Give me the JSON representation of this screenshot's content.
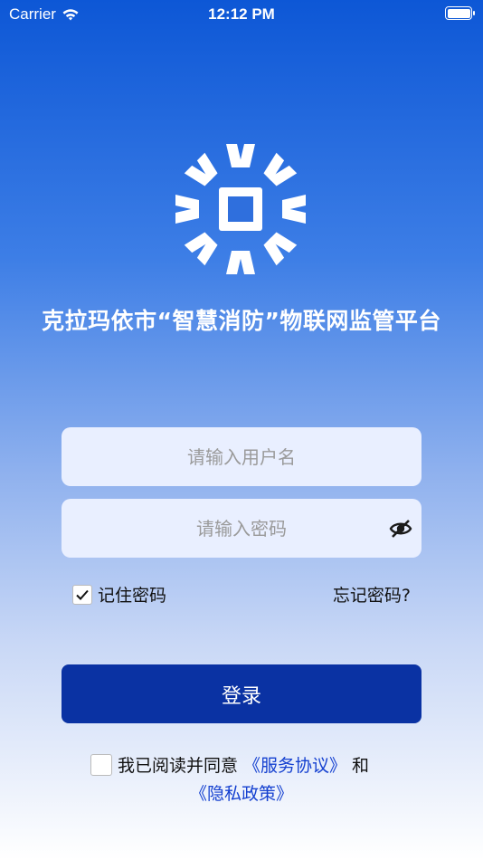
{
  "status_bar": {
    "carrier": "Carrier",
    "time": "12:12 PM"
  },
  "app": {
    "title": "克拉玛依市“智慧消防”物联网监管平台",
    "logo_icon": "fire-iot-logo-icon"
  },
  "login_form": {
    "username_placeholder": "请输入用户名",
    "username_value": "",
    "password_placeholder": "请输入密码",
    "password_value": "",
    "password_toggle_icon": "eye-slash-icon",
    "remember_label": "记住密码",
    "remember_checked": true,
    "forgot_label": "忘记密码?",
    "login_label": "登录"
  },
  "agreement": {
    "checked": false,
    "prefix": "我已阅读并同意",
    "service_link": "《服务协议》",
    "and": "和",
    "privacy_link": "《隐私政策》"
  },
  "colors": {
    "gradient_top": "#0d57d6",
    "input_bg": "#e9efff",
    "button_bg": "#0a32a3",
    "link": "#1440d0"
  }
}
